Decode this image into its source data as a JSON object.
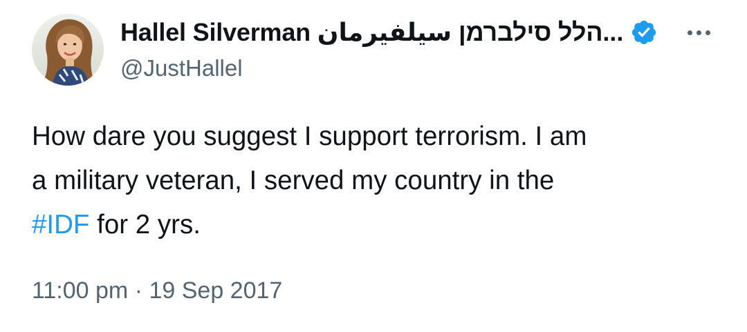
{
  "author": {
    "display_name": "Hallel Silverman הלל סילברמן سيلفيرمان...",
    "handle": "@JustHallel",
    "verified": true,
    "verified_icon": "verified-badge-icon",
    "avatar_alt": "profile photo"
  },
  "menu": {
    "icon": "more-horizontal-icon"
  },
  "tweet": {
    "line1": "How dare you suggest I support terrorism. I am",
    "line2": "a military veteran, I served my country in the",
    "hashtag": "#IDF",
    "line3_rest": " for 2 yrs."
  },
  "meta": {
    "time": "11:00 pm",
    "separator": " · ",
    "date": "19 Sep 2017"
  },
  "colors": {
    "text": "#0f1419",
    "secondary": "#536471",
    "accent": "#1d9bf0"
  }
}
